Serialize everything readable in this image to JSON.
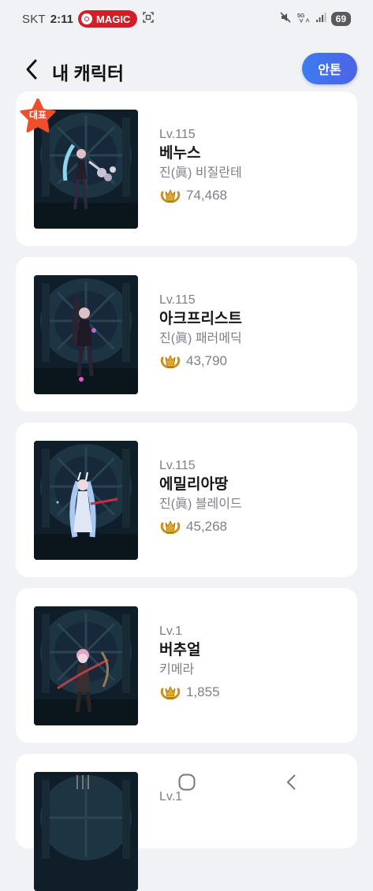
{
  "status_bar": {
    "carrier": "SKT",
    "time": "2:11",
    "magic_label": "MAGIC",
    "network": "5G",
    "battery": "69"
  },
  "header": {
    "title": "내 캐릭터",
    "action_label": "안톤"
  },
  "representative_label": "대표",
  "characters": [
    {
      "level": "Lv.115",
      "name": "베누스",
      "class": "진(眞) 비질란테",
      "power": "74,468",
      "representative": true
    },
    {
      "level": "Lv.115",
      "name": "아크프리스트",
      "class": "진(眞) 패러메딕",
      "power": "43,790",
      "representative": false
    },
    {
      "level": "Lv.115",
      "name": "에밀리아땅",
      "class": "진(眞) 블레이드",
      "power": "45,268",
      "representative": false
    },
    {
      "level": "Lv.1",
      "name": "버추얼",
      "class": "키메라",
      "power": "1,855",
      "representative": false
    },
    {
      "level": "Lv.1"
    }
  ],
  "icons": {
    "back": "chevron-left-icon",
    "power": "laurel-crown-icon",
    "nav_recents": "recents-icon",
    "nav_home": "home-icon",
    "nav_back": "nav-back-icon"
  },
  "colors": {
    "accent": "#3b7cf0",
    "rep_badge": "#ef4e2d",
    "power_icon": "#c8901c",
    "background": "#f1f2f6"
  }
}
